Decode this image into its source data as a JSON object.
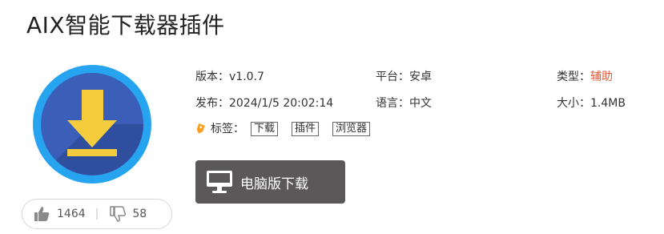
{
  "app": {
    "title": "AIX智能下载器插件",
    "icon": "download-arrow-circle-icon"
  },
  "info": {
    "version_label": "版本：",
    "version": "v1.0.7",
    "platform_label": "平台：",
    "platform": "安卓",
    "type_label": "类型：",
    "type": "辅助",
    "release_label": "发布：",
    "release": "2024/1/5 20:02:14",
    "language_label": "语言：",
    "language": "中文",
    "size_label": "大小：",
    "size": "1.4MB"
  },
  "tags": {
    "label": "标签：",
    "items": [
      "下载",
      "插件",
      "浏览器"
    ]
  },
  "download": {
    "label": "电脑版下载",
    "icon": "monitor-icon"
  },
  "votes": {
    "likes": "1464",
    "dislikes": "58",
    "separator": "|"
  },
  "colors": {
    "accent": "#e05a3a",
    "tag_icon": "#f5a023",
    "button_bg": "#5a5858",
    "icon_ring": "#27a4f0",
    "icon_disc": "#3b5fb8",
    "icon_arrow": "#f4cc3e"
  }
}
